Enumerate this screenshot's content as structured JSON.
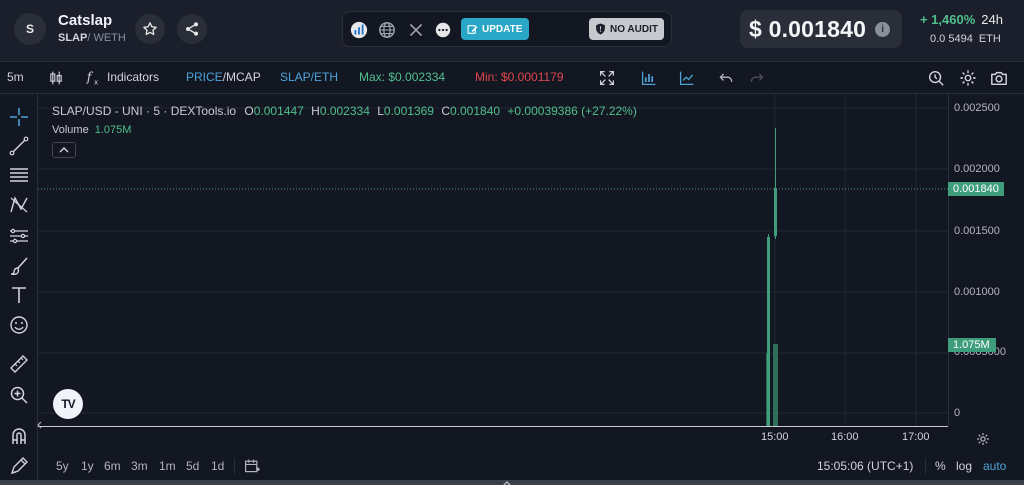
{
  "header": {
    "avatar_letter": "S",
    "token_name": "Catslap",
    "pair_base": "SLAP",
    "pair_quote": "/ WETH",
    "update_label": "UPDATE",
    "no_audit_label": "NO AUDIT",
    "price": "$ 0.001840",
    "info_glyph": "i",
    "change": "+ 1,460%",
    "change_period": "24h",
    "eth_price": "0.0 5494",
    "eth_unit": "ETH"
  },
  "toolbar": {
    "interval": "5m",
    "indicators": "Indicators",
    "price_label": "PRICE",
    "mcap_label": "/MCAP",
    "pair": "SLAP/ETH",
    "max": "Max: $0.002334",
    "min": "Min: $0.0001179"
  },
  "legend": {
    "title": "SLAP/USD - UNI · 5 · DEXTools.io",
    "o_key": "O",
    "o_val": "0.001447",
    "h_key": "H",
    "h_val": "0.002334",
    "l_key": "L",
    "l_val": "0.001369",
    "c_key": "C",
    "c_val": "0.001840",
    "change": "+0.00039386 (+27.22%)",
    "volume_label": "Volume",
    "volume_value": "1.075M"
  },
  "yaxis": {
    "labels": [
      "0.002500",
      "0.002000",
      "0.001500",
      "0.001000",
      "0.0005000",
      "0"
    ],
    "price_tag": "0.001840",
    "volume_tag": "1.075M"
  },
  "xaxis": {
    "labels": [
      "15:00",
      "16:00",
      "17:00"
    ]
  },
  "bottom": {
    "ranges": [
      "5y",
      "1y",
      "6m",
      "3m",
      "1m",
      "5d",
      "1d"
    ],
    "time": "15:05:06 (UTC+1)",
    "percent": "%",
    "log": "log",
    "auto": "auto"
  },
  "logo_text": "TV",
  "colors": {
    "up": "#4fbf8c",
    "down": "#e0474c",
    "accent_blue": "#4da3d9",
    "background": "#131722"
  },
  "icons": {
    "star": "star-icon",
    "share": "share-icon",
    "dextools": "dextools-icon",
    "globe": "globe-icon",
    "x": "x-twitter-icon",
    "more": "more-icon"
  }
}
